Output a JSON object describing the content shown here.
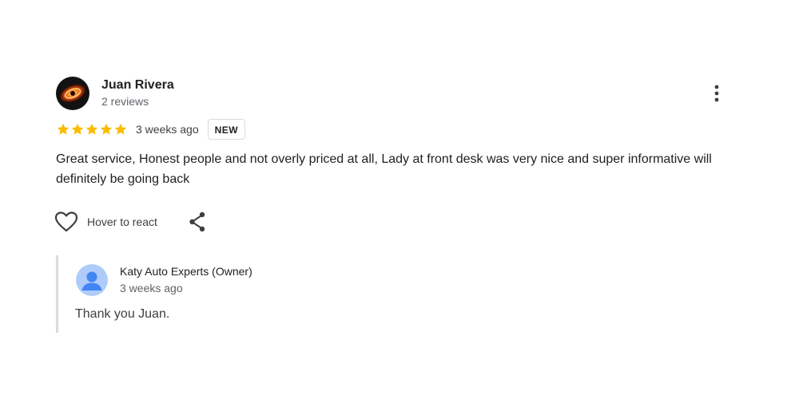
{
  "review": {
    "reviewer_name": "Juan Rivera",
    "reviewer_meta": "2 reviews",
    "rating": 5,
    "rating_max": 5,
    "date": "3 weeks ago",
    "badge": "NEW",
    "text": "Great service, Honest people and not overly priced at all, Lady at front desk was very nice and super informative will definitely be going back"
  },
  "actions": {
    "react_label": "Hover to react"
  },
  "owner_reply": {
    "name": "Katy Auto Experts (Owner)",
    "date": "3 weeks ago",
    "text": "Thank you Juan."
  },
  "icons": {
    "more": "more-vert-icon",
    "react": "heart-outline-icon",
    "share": "share-icon",
    "star": "star-icon"
  },
  "colors": {
    "star": "#fbbc04",
    "owner_avatar_bg": "#aecbfa",
    "owner_avatar_fg": "#4285f4",
    "reply_border": "#dadce0"
  }
}
